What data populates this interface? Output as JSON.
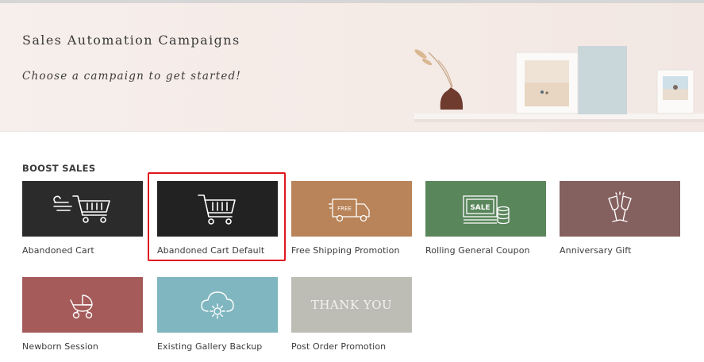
{
  "header": {
    "title": "Sales Automation Campaigns",
    "subtitle": "Choose a campaign to get started!"
  },
  "section": {
    "title": "BOOST SALES"
  },
  "campaigns": [
    {
      "label": "Abandoned Cart",
      "color": "#2b2b2b",
      "icon": "cart-speed-icon",
      "selected": false
    },
    {
      "label": "Abandoned Cart Default",
      "color": "#222222",
      "icon": "shopping-cart-icon",
      "selected": true
    },
    {
      "label": "Free Shipping Promotion",
      "color": "#b98459",
      "icon": "delivery-truck-icon",
      "icon_text": "FREE",
      "selected": false
    },
    {
      "label": "Rolling General Coupon",
      "color": "#5a865c",
      "icon": "sale-coupon-icon",
      "icon_text": "SALE",
      "selected": false
    },
    {
      "label": "Anniversary Gift",
      "color": "#84605f",
      "icon": "champagne-glasses-icon",
      "selected": false
    },
    {
      "label": "Newborn Session",
      "color": "#a45b5a",
      "icon": "baby-stroller-icon",
      "selected": false
    },
    {
      "label": "Existing Gallery Backup",
      "color": "#7fb6bf",
      "icon": "cloud-gear-icon",
      "selected": false
    },
    {
      "label": "Post Order Promotion",
      "color": "#bdbcb5",
      "icon": "thank-you-text",
      "icon_text": "THANK YOU",
      "selected": false
    }
  ],
  "colors": {
    "selection_border": "#e0161d",
    "icon_stroke": "#ffffff"
  }
}
